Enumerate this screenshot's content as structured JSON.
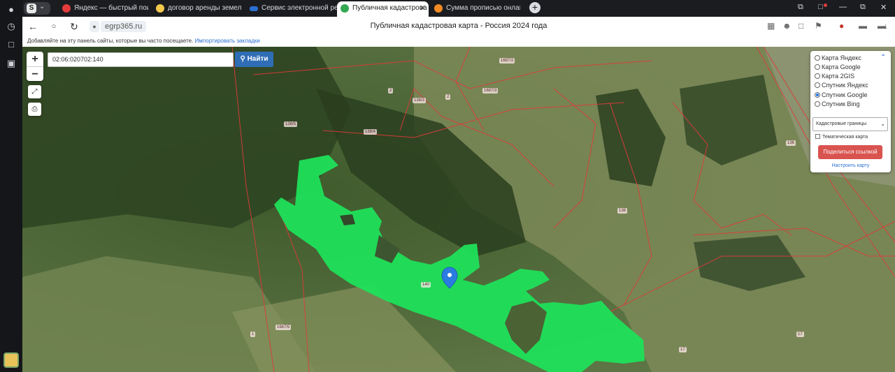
{
  "tabs": [
    {
      "label": "Яндекс — быстрый поиск",
      "favicon_color": "#e23b3b"
    },
    {
      "label": "договор аренды земельн",
      "favicon_color": "#f2c94c"
    },
    {
      "label": "Сервис электронной реги",
      "favicon_color": "#2b6fd1"
    },
    {
      "label": "Публичная кадастрова",
      "favicon_color": "#34a853"
    },
    {
      "label": "Сумма прописью онлайн",
      "favicon_color": "#f28b22"
    }
  ],
  "address": {
    "url": "egrp365.ru"
  },
  "page_title": "Публичная кадастровая карта - Россия 2024 года",
  "bookmarks_hint": {
    "text": "Добавляйте на эту панель сайты, которые вы часто посещаете.",
    "link": "Импортировать закладки"
  },
  "map": {
    "search_value": "02:06:020702:140",
    "find_label": "Найти",
    "zoom_in": "+",
    "zoom_out": "−",
    "plot_labels": [
      "1687/2",
      "1687/3",
      "138/3",
      "138/4",
      "138/5",
      "2",
      "2",
      "136",
      "136",
      "140",
      "1687/5",
      "1",
      "17",
      "17"
    ]
  },
  "layers_panel": {
    "options": [
      "Карта Яндекс",
      "Карта Google",
      "Карта 2GIS",
      "Спутник Яндекс",
      "Спутник Google",
      "Спутник Bing"
    ],
    "selected": "Спутник Google",
    "overlay_select": "Кадастровые границы",
    "thematic_label": "Тематическая карта",
    "share_label": "Поделиться ссылкой",
    "configure_label": "Настроить карту"
  },
  "colors": {
    "highlight_parcel": "#1fe05a",
    "share_button": "#d9534f",
    "find_button": "#2f6db5",
    "boundary": "#e03a3a"
  }
}
